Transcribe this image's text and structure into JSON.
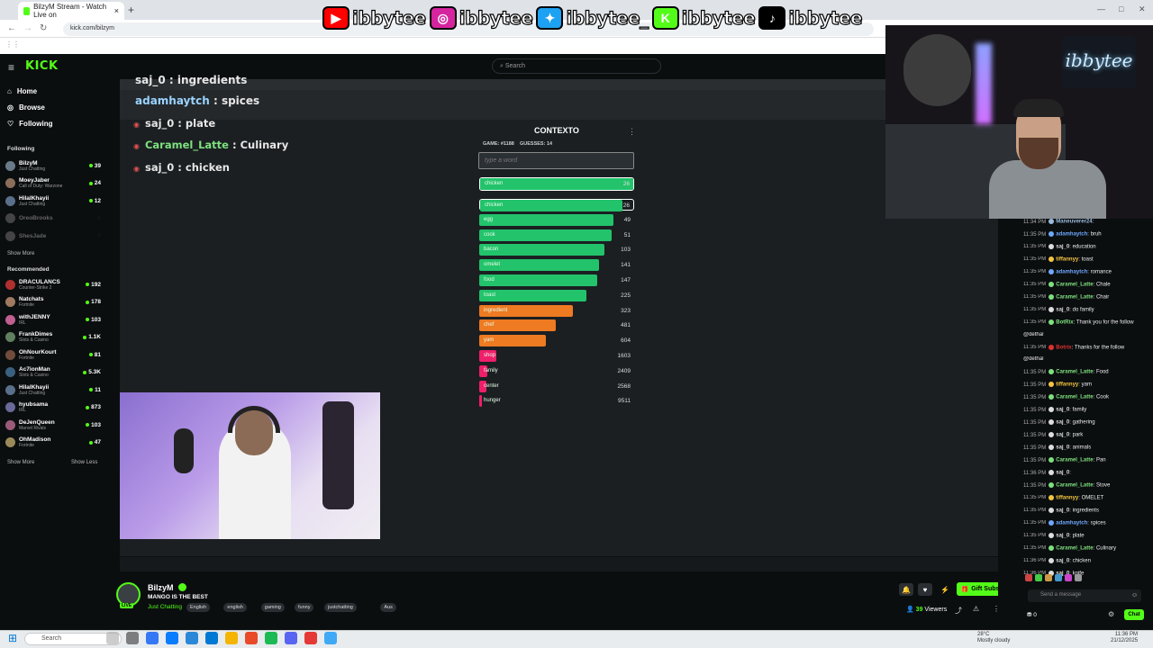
{
  "browser": {
    "tab_title": "BilzyM Stream - Watch Live on",
    "url": "kick.com/bilzym"
  },
  "socials": {
    "handles": [
      {
        "platform": "youtube-icon",
        "handle": "ibbytee",
        "color": "#ff0000"
      },
      {
        "platform": "instagram-icon",
        "handle": "ibbytee",
        "color": "#d6249f"
      },
      {
        "platform": "twitter-icon",
        "handle": "ibbytee_",
        "color": "#1da1f2"
      },
      {
        "platform": "kick-icon",
        "handle": "ibbytee",
        "color": "#53fc18"
      },
      {
        "platform": "tiktok-icon",
        "handle": "ibbytee",
        "color": "#000000"
      }
    ]
  },
  "kick": {
    "logo": "KICK",
    "search_placeholder": "Search",
    "nav": {
      "home": "Home",
      "browse": "Browse",
      "following": "Following"
    },
    "following_header": "Following",
    "following": [
      {
        "name": "BilzyM",
        "game": "Just Chatting",
        "viewers": "39",
        "color": "#6b7a88",
        "online": true
      },
      {
        "name": "MoeyJaber",
        "game": "Call of Duty: Warzone",
        "viewers": "24",
        "color": "#8a6e5a",
        "online": true
      },
      {
        "name": "HilalKhayii",
        "game": "Just Chatting",
        "viewers": "12",
        "color": "#5a6f8a",
        "online": true
      },
      {
        "name": "OreoBrooks",
        "game": "",
        "viewers": "",
        "color": "#444",
        "online": false
      },
      {
        "name": "ShesJade",
        "game": "",
        "viewers": "",
        "color": "#444",
        "online": false
      }
    ],
    "show_more": "Show More",
    "recommended_header": "Recommended",
    "recommended": [
      {
        "name": "DRACULANCS",
        "game": "Counter-Strike 2",
        "viewers": "192",
        "color": "#b03030"
      },
      {
        "name": "Natchats",
        "game": "Fortnite",
        "viewers": "178",
        "color": "#a07a60"
      },
      {
        "name": "withJENNY",
        "game": "IRL",
        "viewers": "103",
        "color": "#c06090"
      },
      {
        "name": "FrankDimes",
        "game": "Slots & Casino",
        "viewers": "1.1K",
        "color": "#608060"
      },
      {
        "name": "OhNourKourt",
        "game": "Fortnite",
        "viewers": "81",
        "color": "#704c3c"
      },
      {
        "name": "Ac7ionMan",
        "game": "Slots & Casino",
        "viewers": "5.3K",
        "color": "#3a6080"
      },
      {
        "name": "HilalKhayii",
        "game": "Just Chatting",
        "viewers": "11",
        "color": "#5a6f8a"
      },
      {
        "name": "hyubsama",
        "game": "IRL",
        "viewers": "873",
        "color": "#6a6a9a"
      },
      {
        "name": "DeJenQueen",
        "game": "Marvel Rivals",
        "viewers": "103",
        "color": "#9a5a7a"
      },
      {
        "name": "OhMadison",
        "game": "Fortnite",
        "viewers": "47",
        "color": "#9a8a5a"
      }
    ],
    "show_more_2": "Show More",
    "show_less": "Show Less"
  },
  "stream_content": {
    "overlay_lines": [
      {
        "user": "saj_0",
        "text": "ingredients"
      },
      {
        "user": "adamhaytch",
        "text": "spices"
      },
      {
        "user": "saj_0",
        "text": "plate"
      },
      {
        "user": "Caramel_Latte",
        "text": "Culinary"
      },
      {
        "user": "saj_0",
        "text": "chicken"
      }
    ],
    "game": {
      "title": "CONTEXTO",
      "game_label": "GAME: #1188",
      "guesses_label": "GUESSES: 14",
      "input_placeholder": "type a word",
      "last_guess": {
        "word": "chicken",
        "rank": "26"
      },
      "guesses": [
        {
          "word": "chicken",
          "rank": "26",
          "fill": 1.0,
          "color": "#22c36b"
        },
        {
          "word": "egg",
          "rank": "49",
          "fill": 0.94,
          "color": "#22c36b"
        },
        {
          "word": "cook",
          "rank": "51",
          "fill": 0.93,
          "color": "#22c36b"
        },
        {
          "word": "bacon",
          "rank": "103",
          "fill": 0.88,
          "color": "#22c36b"
        },
        {
          "word": "omelet",
          "rank": "141",
          "fill": 0.84,
          "color": "#22c36b"
        },
        {
          "word": "food",
          "rank": "147",
          "fill": 0.83,
          "color": "#22c36b"
        },
        {
          "word": "toast",
          "rank": "225",
          "fill": 0.75,
          "color": "#22c36b"
        },
        {
          "word": "ingredient",
          "rank": "323",
          "fill": 0.66,
          "color": "#ee7a22"
        },
        {
          "word": "chef",
          "rank": "481",
          "fill": 0.54,
          "color": "#ee7a22"
        },
        {
          "word": "yam",
          "rank": "604",
          "fill": 0.47,
          "color": "#ee7a22"
        },
        {
          "word": "shop",
          "rank": "1603",
          "fill": 0.12,
          "color": "#ef1e6b"
        },
        {
          "word": "family",
          "rank": "2409",
          "fill": 0.06,
          "color": "#ef1e6b"
        },
        {
          "word": "center",
          "rank": "2568",
          "fill": 0.05,
          "color": "#ef1e6b"
        },
        {
          "word": "hunger",
          "rank": "9511",
          "fill": 0.01,
          "color": "#ef1e6b"
        }
      ]
    }
  },
  "streamer": {
    "name": "BilzyM",
    "title": "MANGO IS THE BEST",
    "category": "Just Chatting",
    "tags": [
      "English",
      "english",
      "gaming",
      "funny",
      "justchatting",
      "Aus"
    ],
    "live_label": "LIVE",
    "gift_subs": "Gift Subs",
    "viewers": "39",
    "viewers_label": "Viewers"
  },
  "facecam": {
    "neon_text": "ibbytee"
  },
  "chat": {
    "messages": [
      {
        "time": "11:34 PM",
        "user": "Maneuverer24",
        "text": "",
        "color": "#9bd"
      },
      {
        "time": "11:35 PM",
        "user": "adamhaytch",
        "text": "bruh",
        "color": "#6fa8ff"
      },
      {
        "time": "11:35 PM",
        "user": "saj_0",
        "text": "education",
        "color": "#ddd"
      },
      {
        "time": "11:35 PM",
        "user": "tiffannyy",
        "text": "toast",
        "color": "#f5c542"
      },
      {
        "time": "11:35 PM",
        "user": "adamhaytch",
        "text": "romance",
        "color": "#6fa8ff"
      },
      {
        "time": "11:35 PM",
        "user": "Caramel_Latte",
        "text": "Chale",
        "color": "#7ee07e"
      },
      {
        "time": "11:35 PM",
        "user": "Caramel_Latte",
        "text": "Chair",
        "color": "#7ee07e"
      },
      {
        "time": "11:35 PM",
        "user": "saj_0",
        "text": "do family",
        "color": "#ddd"
      },
      {
        "time": "11:35 PM",
        "user": "BotRix",
        "text": "Thank you for the follow",
        "color": "#7ee07e"
      },
      {
        "time": "",
        "user": "",
        "text": "@dethal",
        "color": "#ddd"
      },
      {
        "time": "11:35 PM",
        "user": "Botrix",
        "text": "Thanks for the follow",
        "color": "#e03030"
      },
      {
        "time": "",
        "user": "",
        "text": "@dethal",
        "color": "#ddd"
      },
      {
        "time": "11:35 PM",
        "user": "Caramel_Latte",
        "text": "Food",
        "color": "#7ee07e"
      },
      {
        "time": "11:35 PM",
        "user": "tiffannyy",
        "text": "yam",
        "color": "#f5c542"
      },
      {
        "time": "11:35 PM",
        "user": "Caramel_Latte",
        "text": "Cook",
        "color": "#7ee07e"
      },
      {
        "time": "11:35 PM",
        "user": "saj_0",
        "text": "family",
        "color": "#ddd"
      },
      {
        "time": "11:35 PM",
        "user": "saj_0",
        "text": "gathering",
        "color": "#ddd"
      },
      {
        "time": "11:35 PM",
        "user": "saj_0",
        "text": "park",
        "color": "#ddd"
      },
      {
        "time": "11:35 PM",
        "user": "saj_0",
        "text": "animals",
        "color": "#ddd"
      },
      {
        "time": "11:35 PM",
        "user": "Caramel_Latte",
        "text": "Pan",
        "color": "#7ee07e"
      },
      {
        "time": "11:36 PM",
        "user": "saj_0",
        "text": "",
        "color": "#ddd"
      },
      {
        "time": "11:35 PM",
        "user": "Caramel_Latte",
        "text": "Stove",
        "color": "#7ee07e"
      },
      {
        "time": "11:35 PM",
        "user": "tiffannyy",
        "text": "OMELET",
        "color": "#f5c542"
      },
      {
        "time": "11:35 PM",
        "user": "saj_0",
        "text": "ingredients",
        "color": "#ddd"
      },
      {
        "time": "11:35 PM",
        "user": "adamhaytch",
        "text": "spices",
        "color": "#6fa8ff"
      },
      {
        "time": "11:35 PM",
        "user": "saj_0",
        "text": "plate",
        "color": "#ddd"
      },
      {
        "time": "11:35 PM",
        "user": "Caramel_Latte",
        "text": "Culinary",
        "color": "#7ee07e"
      },
      {
        "time": "11:36 PM",
        "user": "saj_0",
        "text": "chicken",
        "color": "#ddd"
      },
      {
        "time": "11:36 PM",
        "user": "saj_0",
        "text": "knife",
        "color": "#ddd"
      }
    ],
    "input_placeholder": "Send a message",
    "points": "0",
    "send_label": "Chat"
  },
  "windows": {
    "search": "Search",
    "weather_temp": "28°C",
    "weather_desc": "Mostly cloudy",
    "time": "11:36 PM",
    "date": "21/12/2025"
  }
}
